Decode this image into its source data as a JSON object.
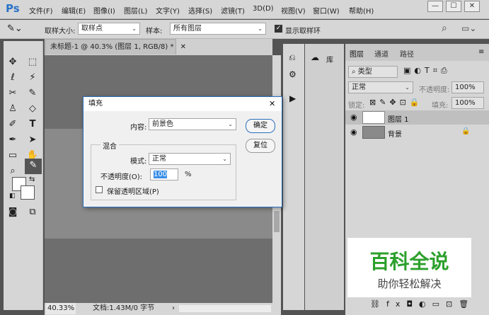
{
  "app": {
    "logo": "Ps"
  },
  "menu": [
    "文件(F)",
    "编辑(E)",
    "图像(I)",
    "图层(L)",
    "文字(Y)",
    "选择(S)",
    "滤镜(T)",
    "3D(D)",
    "视图(V)",
    "窗口(W)",
    "帮助(H)"
  ],
  "window_controls": {
    "minimize": "—",
    "maximize": "☐",
    "close": "✕"
  },
  "options": {
    "sample_size_label": "取样大小:",
    "sample_size_value": "取样点",
    "sample_label": "样本:",
    "sample_value": "所有图层",
    "show_ring_label": "显示取样环",
    "show_ring_checked": true
  },
  "document": {
    "tab_title": "未标题-1 @ 40.3% (图层 1, RGB/8) *",
    "tab_close": "✕",
    "zoom": "40.33%",
    "doc_info": "文档:1.43M/0 字节"
  },
  "library": {
    "label": "库"
  },
  "layers_panel": {
    "tabs": [
      "图层",
      "通道",
      "路径"
    ],
    "filter_kind": "类型",
    "blend_mode": "正常",
    "opacity_label": "不透明度:",
    "opacity_value": "100%",
    "lock_label": "锁定:",
    "fill_label": "填充:",
    "fill_value": "100%",
    "layers": [
      {
        "name": "图层 1",
        "selected": true
      },
      {
        "name": "背景",
        "selected": false,
        "locked": true
      }
    ]
  },
  "fill_dialog": {
    "title": "填充",
    "close": "✕",
    "content_label": "内容:",
    "content_value": "前景色",
    "blend_group": "混合",
    "mode_label": "模式:",
    "mode_value": "正常",
    "opacity_label": "不透明度(O):",
    "opacity_value": "100",
    "opacity_unit": "%",
    "preserve_label": "保留透明区域(P)",
    "preserve_checked": false,
    "ok_label": "确定",
    "reset_label": "复位"
  },
  "watermark": {
    "title": "百科全说",
    "subtitle": "助你轻松解决",
    "title_color": "#2ca02c"
  },
  "colors": {
    "accent": "#2a73c8",
    "selection": "#3a8ee6"
  }
}
